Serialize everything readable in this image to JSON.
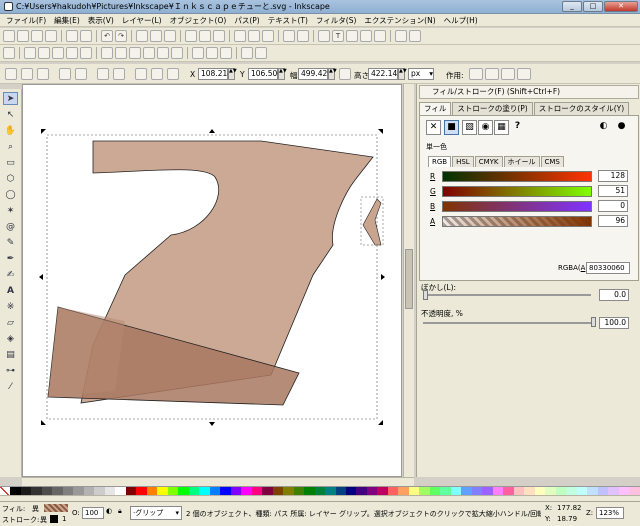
{
  "window": {
    "title": "C:¥Users¥hakudoh¥Pictures¥Inkscape¥Ｉｎｋｓｃａｐｅチューと.svg - Inkscape"
  },
  "menu": [
    "ファイル(F)",
    "編集(E)",
    "表示(V)",
    "レイヤー(L)",
    "オブジェクト(O)",
    "パス(P)",
    "テキスト(T)",
    "フィルタ(S)",
    "エクステンション(N)",
    "ヘルプ(H)"
  ],
  "toolopts": {
    "x_label": "X",
    "x_value": "108.214",
    "y_label": "Y",
    "y_value": "106.500",
    "w_label": "幅",
    "w_value": "499.429",
    "h_label": "高さ",
    "h_value": "422.143",
    "unit": "px",
    "affect_label": "作用:"
  },
  "panel": {
    "title": "フィル/ストローク(F) (Shift+Ctrl+F)",
    "tabs": [
      "フィル",
      "ストロークの塗り(P)",
      "ストロークのスタイル(Y)"
    ],
    "mode_label": "単一色",
    "color_tabs": [
      "RGB",
      "HSL",
      "CMYK",
      "ホイール",
      "CMS"
    ],
    "channels": [
      {
        "label": "R",
        "value": "128"
      },
      {
        "label": "G",
        "value": "51"
      },
      {
        "label": "B",
        "value": "0"
      },
      {
        "label": "A",
        "value": "96"
      }
    ],
    "rgba_label": "RGBA(",
    "rgba_label2": "):",
    "rgba_value": "80330060",
    "blur_label": "ぼかし(L):",
    "blur_value": "0.0",
    "opacity_label": "不透明度, %",
    "opacity_value": "100.0"
  },
  "status": {
    "fill_label": "フィル:",
    "fill_value": "異",
    "stroke_label": "ストローク:",
    "stroke_value": "異",
    "stroke_width": "1",
    "o_label": "O:",
    "o_value": "100",
    "layer_value": "·グリップ",
    "message": "2 個のオブジェクト、種類: パス 所属: レイヤー グリップ。選択オブジェクトのクリックで拡大縮小ハンドル/回転ハン...",
    "x_label": "X:",
    "x_value": "177.82",
    "y_label": "Y:",
    "y_value": "18.79",
    "z_label": "Z:",
    "zoom": "123%"
  },
  "colors": {
    "shape_fill": "#c9a48e",
    "shape_fill2": "#a87860",
    "palette": [
      "#000000",
      "#1a1a1a",
      "#333333",
      "#4d4d4d",
      "#666666",
      "#808080",
      "#999999",
      "#b3b3b3",
      "#cccccc",
      "#e6e6e6",
      "#ffffff",
      "#800000",
      "#ff0000",
      "#ff8000",
      "#ffff00",
      "#80ff00",
      "#00ff00",
      "#00ff80",
      "#00ffff",
      "#0080ff",
      "#0000ff",
      "#8000ff",
      "#ff00ff",
      "#ff0080",
      "#800040",
      "#804000",
      "#808000",
      "#408000",
      "#008000",
      "#008040",
      "#008080",
      "#004080",
      "#000080",
      "#400080",
      "#800080",
      "#c00060",
      "#ff6060",
      "#ffa060",
      "#ffff80",
      "#a0ff60",
      "#60ff60",
      "#60ffa0",
      "#80ffff",
      "#60a0ff",
      "#8080ff",
      "#a060ff",
      "#ff80ff",
      "#ff60a0",
      "#ffc0c0",
      "#ffe0c0",
      "#ffffc0",
      "#e0ffc0",
      "#c0ffc0",
      "#c0ffe0",
      "#c0ffff",
      "#c0e0ff",
      "#c0c0ff",
      "#e0c0ff",
      "#ffc0ff",
      "#ffc0e0"
    ]
  },
  "icons": {
    "toolbox": [
      "selector-arrow-icon",
      "node-edit-icon",
      "tweak-icon",
      "zoom-icon",
      "rectangle-icon",
      "3d-box-icon",
      "ellipse-icon",
      "star-icon",
      "spiral-icon",
      "pencil-icon",
      "pen-icon",
      "calligraphy-icon",
      "text-icon",
      "spray-icon",
      "eraser-icon",
      "bucket-icon",
      "gradient-icon",
      "mesh-icon",
      "dropper-icon"
    ]
  }
}
